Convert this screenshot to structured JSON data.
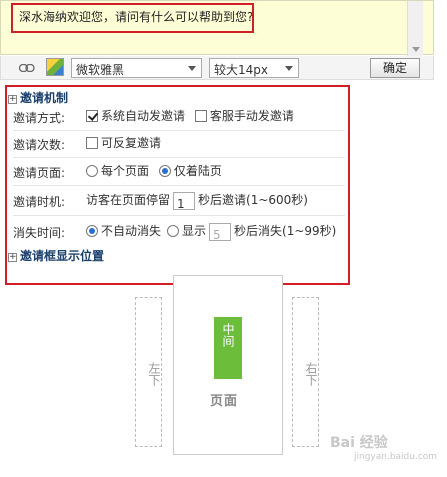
{
  "greeting": {
    "text": "深水海纳欢迎您，请问有什么可以帮助到您?"
  },
  "toolbar": {
    "font_value": "微软雅黑",
    "size_value": "较大14px",
    "confirm_label": "确定"
  },
  "invite": {
    "section_title": "邀请机制",
    "method": {
      "label": "邀请方式:",
      "opt_auto": "系统自动发邀请",
      "opt_manual": "客服手动发邀请"
    },
    "count": {
      "label": "邀请次数:",
      "opt_repeat": "可反复邀请"
    },
    "page": {
      "label": "邀请页面:",
      "opt_every": "每个页面",
      "opt_landing": "仅着陆页"
    },
    "timing": {
      "label": "邀请时机:",
      "prefix": "访客在页面停留",
      "value": "1",
      "suffix": "秒后邀请(1~600秒)"
    },
    "dismiss": {
      "label": "消失时间:",
      "opt_never": "不自动消失",
      "opt_show": "显示",
      "value": "5",
      "suffix": "秒后消失(1~99秒)"
    }
  },
  "position": {
    "section_title": "邀请框显示位置",
    "left_label": "左下",
    "center_label": "中间",
    "right_label": "右下",
    "page_label": "页面"
  },
  "watermark": {
    "text": "Bai 经验",
    "sub": "jingyan.baidu.com"
  },
  "colors": {
    "highlight_border": "#d21f26",
    "center_green": "#6cbd3a",
    "section_title": "#1a3f6b",
    "greeting_bg": "#fefed6"
  }
}
